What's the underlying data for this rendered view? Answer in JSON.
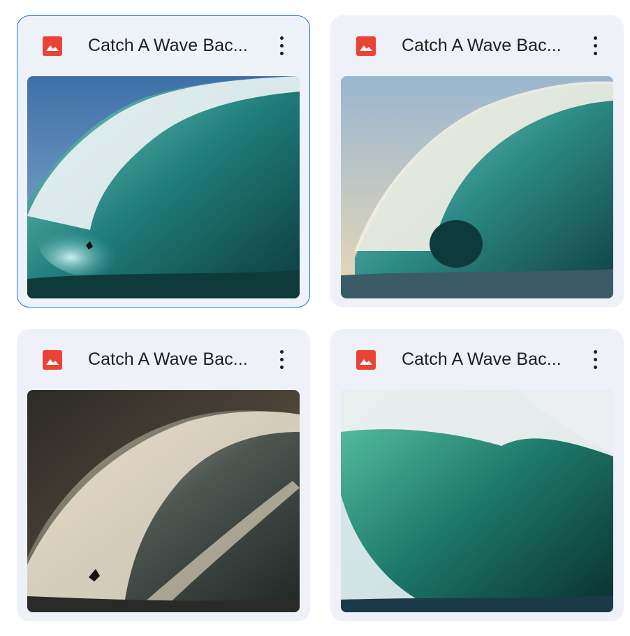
{
  "files": [
    {
      "title": "Catch A Wave Bac...",
      "icon": "image-file-icon",
      "selected": true
    },
    {
      "title": "Catch A Wave Bac...",
      "icon": "image-file-icon",
      "selected": false
    },
    {
      "title": "Catch A Wave Bac...",
      "icon": "image-file-icon",
      "selected": false
    },
    {
      "title": "Catch A Wave Bac...",
      "icon": "image-file-icon",
      "selected": false
    }
  ],
  "colors": {
    "card_bg": "#eef1f7",
    "selected_border": "#1a73e8",
    "icon_red": "#ea4335",
    "title_text": "#1f1f1f"
  }
}
